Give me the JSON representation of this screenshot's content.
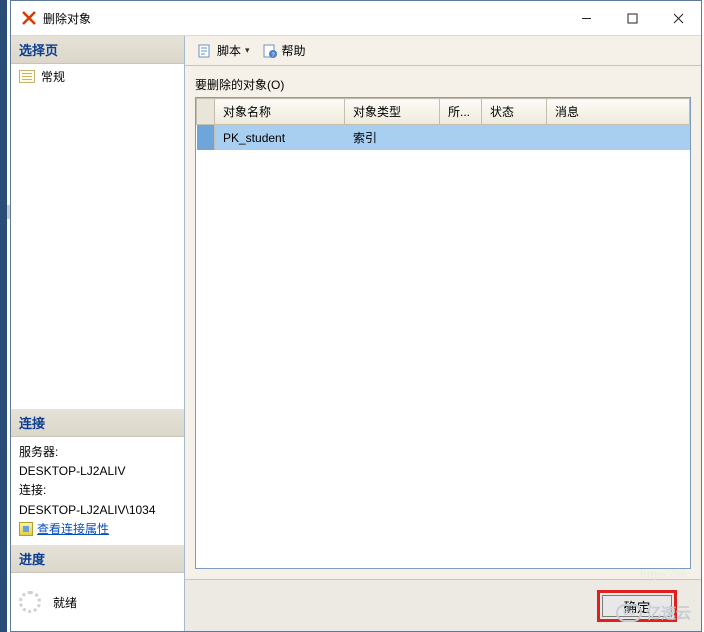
{
  "window": {
    "title": "删除对象"
  },
  "sidebar": {
    "select_page_header": "选择页",
    "general_item": "常规",
    "connection_header": "连接",
    "server_label": "服务器:",
    "server_value": "DESKTOP-LJ2ALIV",
    "conn_label": "连接:",
    "conn_value": "DESKTOP-LJ2ALIV\\1034",
    "view_props_link": "查看连接属性",
    "progress_header": "进度",
    "progress_status": "就绪"
  },
  "toolbar": {
    "script_label": "脚本",
    "help_label": "帮助"
  },
  "main": {
    "group_label": "要删除的对象(O)",
    "columns": {
      "name": "对象名称",
      "type": "对象类型",
      "owner": "所...",
      "status": "状态",
      "message": "消息"
    },
    "rows": [
      {
        "name": "PK_student",
        "type": "索引",
        "owner": "",
        "status": "",
        "message": ""
      }
    ]
  },
  "footer": {
    "ok_label": "确定"
  },
  "watermark": {
    "text": "亿速云",
    "badge": "6o"
  }
}
